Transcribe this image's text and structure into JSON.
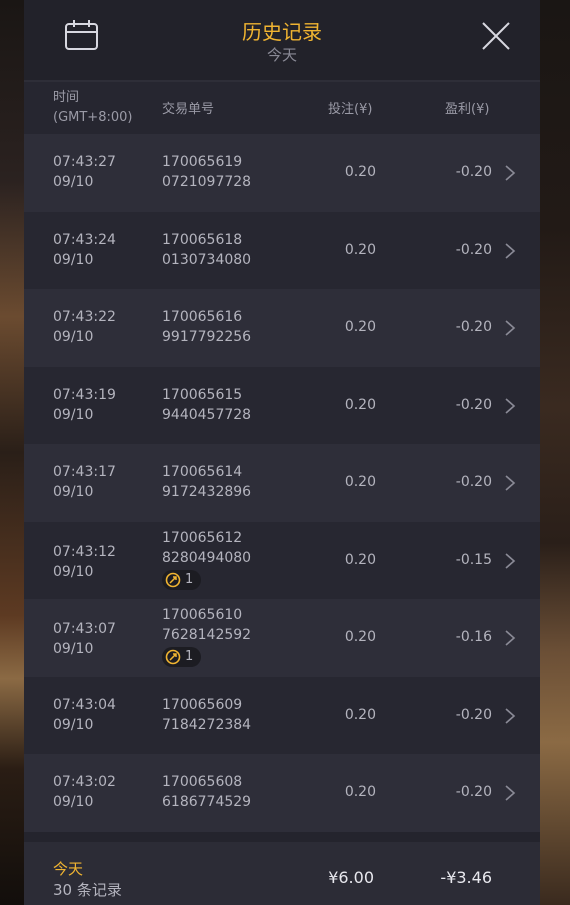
{
  "header": {
    "title": "历史记录",
    "subtitle": "今天",
    "calendar_icon": "calendar-icon",
    "close_icon": "close-icon"
  },
  "columns": {
    "time": "时间",
    "timezone": "(GMT+8:00)",
    "trade_id": "交易单号",
    "bet": "投注(¥)",
    "profit": "盈利(¥)"
  },
  "rows": [
    {
      "time": "07:43:27",
      "date": "09/10",
      "id1": "170065619",
      "id2": "0721097728",
      "bet": "0.20",
      "profit": "-0.20",
      "badge": null
    },
    {
      "time": "07:43:24",
      "date": "09/10",
      "id1": "170065618",
      "id2": "0130734080",
      "bet": "0.20",
      "profit": "-0.20",
      "badge": null
    },
    {
      "time": "07:43:22",
      "date": "09/10",
      "id1": "170065616",
      "id2": "9917792256",
      "bet": "0.20",
      "profit": "-0.20",
      "badge": null
    },
    {
      "time": "07:43:19",
      "date": "09/10",
      "id1": "170065615",
      "id2": "9440457728",
      "bet": "0.20",
      "profit": "-0.20",
      "badge": null
    },
    {
      "time": "07:43:17",
      "date": "09/10",
      "id1": "170065614",
      "id2": "9172432896",
      "bet": "0.20",
      "profit": "-0.20",
      "badge": null
    },
    {
      "time": "07:43:12",
      "date": "09/10",
      "id1": "170065612",
      "id2": "8280494080",
      "bet": "0.20",
      "profit": "-0.15",
      "badge": "1"
    },
    {
      "time": "07:43:07",
      "date": "09/10",
      "id1": "170065610",
      "id2": "7628142592",
      "bet": "0.20",
      "profit": "-0.16",
      "badge": "1"
    },
    {
      "time": "07:43:04",
      "date": "09/10",
      "id1": "170065609",
      "id2": "7184272384",
      "bet": "0.20",
      "profit": "-0.20",
      "badge": null
    },
    {
      "time": "07:43:02",
      "date": "09/10",
      "id1": "170065608",
      "id2": "6186774529",
      "bet": "0.20",
      "profit": "-0.20",
      "badge": null
    }
  ],
  "footer": {
    "label": "今天",
    "count": "30 条记录",
    "total_bet": "¥6.00",
    "total_profit": "-¥3.46"
  },
  "colors": {
    "accent": "#f0b431",
    "panel": "#24242d"
  }
}
